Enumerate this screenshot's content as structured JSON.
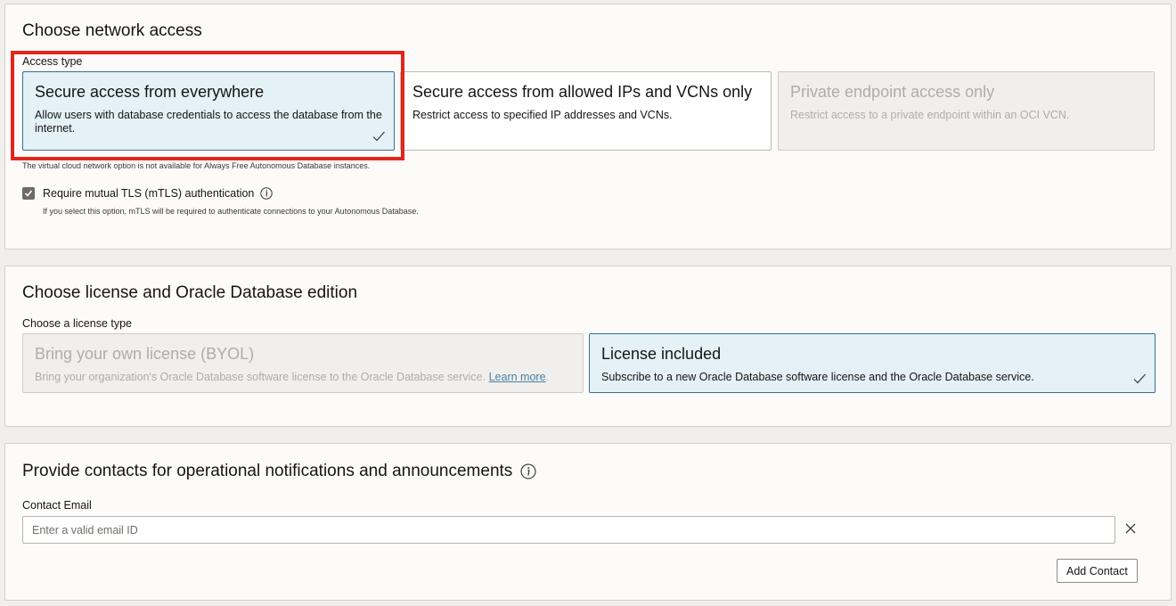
{
  "network": {
    "title": "Choose network access",
    "access_type_label": "Access type",
    "options": [
      {
        "title": "Secure access from everywhere",
        "desc": "Allow users with database credentials to access the database from the internet.",
        "state": "selected"
      },
      {
        "title": "Secure access from allowed IPs and VCNs only",
        "desc": "Restrict access to specified IP addresses and VCNs.",
        "state": "default"
      },
      {
        "title": "Private endpoint access only",
        "desc": "Restrict access to a private endpoint within an OCI VCN.",
        "state": "disabled"
      }
    ],
    "vcn_note": "The virtual cloud network option is not available for Always Free Autonomous Database instances.",
    "mtls_label": "Require mutual TLS (mTLS) authentication",
    "mtls_checked": true,
    "mtls_help": "If you select this option, mTLS will be required to authenticate connections to your Autonomous Database."
  },
  "license": {
    "title": "Choose license and Oracle Database edition",
    "type_label": "Choose a license type",
    "byol": {
      "title": "Bring your own license (BYOL)",
      "desc": "Bring your organization's Oracle Database software license to the Oracle Database service.",
      "link": "Learn more",
      "suffix": ".",
      "state": "disabled"
    },
    "included": {
      "title": "License included",
      "desc": "Subscribe to a new Oracle Database software license and the Oracle Database service.",
      "state": "selected"
    }
  },
  "contacts": {
    "title": "Provide contacts for operational notifications and announcements",
    "email_label": "Contact Email",
    "email_placeholder": "Enter a valid email ID",
    "email_value": "",
    "add_button": "Add Contact"
  },
  "colors": {
    "selected_bg": "#e4f1f7",
    "selected_border": "#3a6e8f",
    "highlight": "#e3261b"
  }
}
